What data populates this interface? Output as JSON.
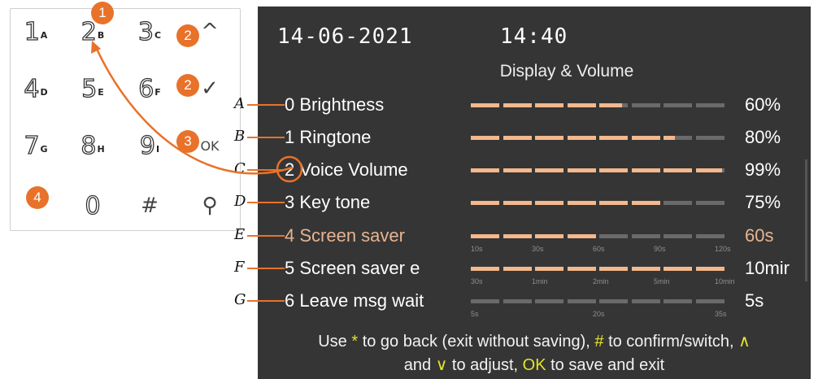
{
  "keypad": {
    "keys": [
      {
        "main": "1",
        "sub": "A"
      },
      {
        "main": "2",
        "sub": "B"
      },
      {
        "main": "3",
        "sub": "C"
      },
      {
        "main": "^",
        "sub": ""
      },
      {
        "main": "4",
        "sub": "D"
      },
      {
        "main": "5",
        "sub": "E"
      },
      {
        "main": "6",
        "sub": "F"
      },
      {
        "main": "✓",
        "sub": ""
      },
      {
        "main": "7",
        "sub": "G"
      },
      {
        "main": "8",
        "sub": "H"
      },
      {
        "main": "9",
        "sub": "I"
      },
      {
        "main": "OK",
        "sub": ""
      },
      {
        "main": "*",
        "sub": ""
      },
      {
        "main": "0",
        "sub": ""
      },
      {
        "main": "#",
        "sub": ""
      },
      {
        "main": "⚲",
        "sub": ""
      }
    ],
    "badges": [
      "1",
      "2",
      "2",
      "3",
      "4"
    ]
  },
  "screen": {
    "date": "14-06-2021",
    "time": "14:40",
    "title": "Display & Volume",
    "rows": [
      {
        "letter": "A",
        "label": "0 Brightness",
        "value": "60%",
        "level": 0.6,
        "scale": []
      },
      {
        "letter": "B",
        "label": "1 Ringtone",
        "value": "80%",
        "level": 0.8,
        "scale": []
      },
      {
        "letter": "C",
        "label": "2 Voice Volume",
        "value": "99%",
        "level": 0.99,
        "scale": []
      },
      {
        "letter": "D",
        "label": "3 Key tone",
        "value": "75%",
        "level": 0.75,
        "scale": []
      },
      {
        "letter": "E",
        "label": "4 Screen saver",
        "value": "60s",
        "level": 0.5,
        "scale": [
          "10s",
          "30s",
          "60s",
          "90s",
          "120s"
        ]
      },
      {
        "letter": "F",
        "label": "5 Screen saver e",
        "value": "10mir",
        "level": 1.0,
        "scale": [
          "30s",
          "1min",
          "2min",
          "5min",
          "10min"
        ]
      },
      {
        "letter": "G",
        "label": "6 Leave msg wait",
        "value": "5s",
        "level": 0.0,
        "scale": [
          "5s",
          "20s",
          "35s"
        ]
      }
    ],
    "footer": {
      "p1": "Use ",
      "star": "*",
      "p2": " to go back (exit without saving), ",
      "hash": "#",
      "p3": " to confirm/switch, ",
      "up": "∧",
      "p4": "and ",
      "down": "∨",
      "p5": " to adjust, ",
      "ok": "OK",
      "p6": " to save and exit"
    }
  },
  "colors": {
    "accent": "#e8722a",
    "bar_on": "#f4b88c",
    "bar_off": "#6a6a6a",
    "screen_bg": "#353535",
    "highlight": "#e3e32a"
  }
}
